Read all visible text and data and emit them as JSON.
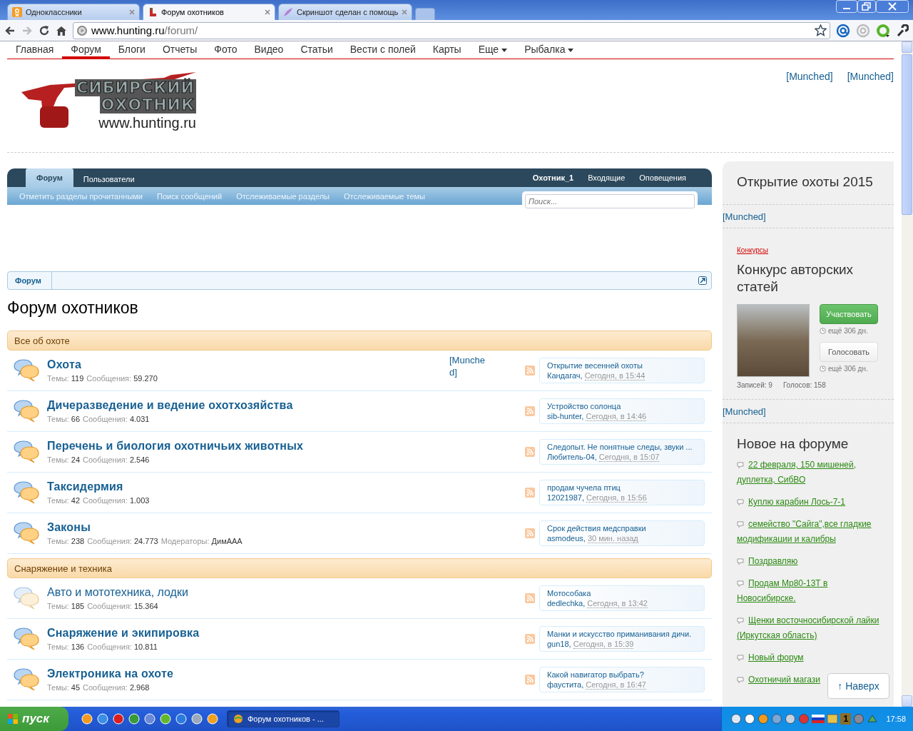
{
  "browser": {
    "tabs": [
      {
        "title": "Одноклассники",
        "selected": false,
        "kind": "ok"
      },
      {
        "title": "Форум охотников",
        "selected": true,
        "kind": "hunting"
      },
      {
        "title": "Скриншот сделан с помощь",
        "selected": false,
        "kind": "feather"
      }
    ],
    "address": {
      "host": "www.hunting.ru",
      "path": "/forum/"
    }
  },
  "site_nav": {
    "items": [
      {
        "label": "Главная",
        "selected": false,
        "dropdown": false
      },
      {
        "label": "Форум",
        "selected": true,
        "dropdown": false
      },
      {
        "label": "Блоги",
        "selected": false,
        "dropdown": false
      },
      {
        "label": "Отчеты",
        "selected": false,
        "dropdown": false
      },
      {
        "label": "Фото",
        "selected": false,
        "dropdown": false
      },
      {
        "label": "Видео",
        "selected": false,
        "dropdown": false
      },
      {
        "label": "Статьи",
        "selected": false,
        "dropdown": false
      },
      {
        "label": "Вести с полей",
        "selected": false,
        "dropdown": false
      },
      {
        "label": "Карты",
        "selected": false,
        "dropdown": false
      },
      {
        "label": "Еще",
        "selected": false,
        "dropdown": true
      },
      {
        "label": "Рыбалка",
        "selected": false,
        "dropdown": true
      }
    ]
  },
  "header": {
    "logo": {
      "line1": "СИБИРСКИЙ",
      "line2": "ОХОТНИК",
      "url": "www.hunting.ru"
    },
    "links": [
      "[Munched]",
      "[Munched]"
    ]
  },
  "forum_nav": {
    "tabs": [
      {
        "label": "Форум",
        "selected": true
      },
      {
        "label": "Пользователи",
        "selected": false
      }
    ],
    "user": "Охотник_1",
    "user_links": [
      "Входящие",
      "Оповещения"
    ],
    "sub_links": [
      "Отметить разделы прочитанными",
      "Поиск сообщений",
      "Отслеживаемые разделы",
      "Отслеживаемые темы"
    ],
    "search": {
      "placeholder": "Поиск..."
    }
  },
  "breadcrumb": {
    "items": [
      "Форум"
    ]
  },
  "title": "Форум охотников",
  "categories": [
    {
      "title": "Все об охоте",
      "forums": [
        {
          "title": "Охота",
          "unread": true,
          "ad_link": "[Munched]",
          "stats": [
            {
              "label": "Темы:",
              "value": "119"
            },
            {
              "label": "Сообщения:",
              "value": "59.270"
            }
          ],
          "last_post": {
            "title": "Открытие весенней охоты",
            "author": "Кандагач,",
            "time": "Сегодня, в 15:44"
          }
        },
        {
          "title": "Дичеразведение и ведение охотхозяйства",
          "unread": true,
          "stats": [
            {
              "label": "Темы:",
              "value": "66"
            },
            {
              "label": "Сообщения:",
              "value": "4.031"
            }
          ],
          "last_post": {
            "title": "Устройство солонца",
            "author": "sib-hunter,",
            "time": "Сегодня, в 14:46"
          }
        },
        {
          "title": "Перечень и биология охотничьих животных",
          "unread": true,
          "stats": [
            {
              "label": "Темы:",
              "value": "24"
            },
            {
              "label": "Сообщения:",
              "value": "2.546"
            }
          ],
          "last_post": {
            "title": "Следопыт. Не понятные следы, звуки ...",
            "author": "Любитель-04,",
            "time": "Сегодня, в 15:07"
          }
        },
        {
          "title": "Таксидермия",
          "unread": true,
          "stats": [
            {
              "label": "Темы:",
              "value": "42"
            },
            {
              "label": "Сообщения:",
              "value": "1.003"
            }
          ],
          "last_post": {
            "title": "продам чучела птиц",
            "author": "12021987,",
            "time": "Сегодня, в 15:56"
          }
        },
        {
          "title": "Законы",
          "unread": true,
          "stats": [
            {
              "label": "Темы:",
              "value": "238"
            },
            {
              "label": "Сообщения:",
              "value": "24.773"
            },
            {
              "label": "Модераторы:",
              "value": "ДимААА"
            }
          ],
          "last_post": {
            "title": "Срок действия медсправки",
            "author": "asmodeus,",
            "time": "30 мин. назад"
          }
        }
      ]
    },
    {
      "title": "Снаряжение и техника",
      "forums": [
        {
          "title": "Авто и мототехника, лодки",
          "unread": false,
          "stats": [
            {
              "label": "Темы:",
              "value": "185"
            },
            {
              "label": "Сообщения:",
              "value": "15.364"
            }
          ],
          "last_post": {
            "title": "Мотособака",
            "author": "dedlechka,",
            "time": "Сегодня, в 13:42"
          }
        },
        {
          "title": "Снаряжение и экипировка",
          "unread": true,
          "stats": [
            {
              "label": "Темы:",
              "value": "136"
            },
            {
              "label": "Сообщения:",
              "value": "10.811"
            }
          ],
          "last_post": {
            "title": "Манки и искусство приманивания дичи.",
            "author": "gun18,",
            "time": "Сегодня, в 15:39"
          }
        },
        {
          "title": "Электроника на охоте",
          "unread": true,
          "stats": [
            {
              "label": "Темы:",
              "value": "45"
            },
            {
              "label": "Сообщения:",
              "value": "2.968"
            }
          ],
          "last_post": {
            "title": "Какой навигатор выбрать?",
            "author": "фаустита,",
            "time": "Сегодня, в 16:47"
          }
        }
      ]
    }
  ],
  "sidebar": {
    "promo": {
      "title": "Открытие охоты 2015",
      "link": "[Munched]"
    },
    "contest": {
      "category": "Конкурсы",
      "title": "Конкурс авторских статей",
      "actions": [
        {
          "label": "Участвовать",
          "kind": "primary",
          "remaining": "ещё 306 дн."
        },
        {
          "label": "Голосовать",
          "kind": "secondary",
          "remaining": "ещё 306 дн."
        }
      ],
      "stats": [
        "Записей: 9",
        "Голосов: 158"
      ],
      "link": "[Munched]"
    },
    "new_posts": {
      "title": "Новое на форуме",
      "items": [
        "22 февраля, 150 мишеней, дуплетка, СибВО",
        "Куплю карабин Лось-7-1",
        "семейство \"Сайга\",все гладкие модификации и калибры",
        "Поздравляю",
        "Продам Мр80-13Т в Новосибирске.",
        "Щенки восточносибирской лайки (Иркутская область)",
        "Новый форум",
        "Охотничий магази"
      ]
    }
  },
  "back_to_top": "↑ Наверх",
  "taskbar": {
    "start": "пуск",
    "tasks": [
      {
        "title": "Форум охотников - ...",
        "selected": true
      }
    ],
    "tray_number": "1",
    "clock": "17:58"
  }
}
